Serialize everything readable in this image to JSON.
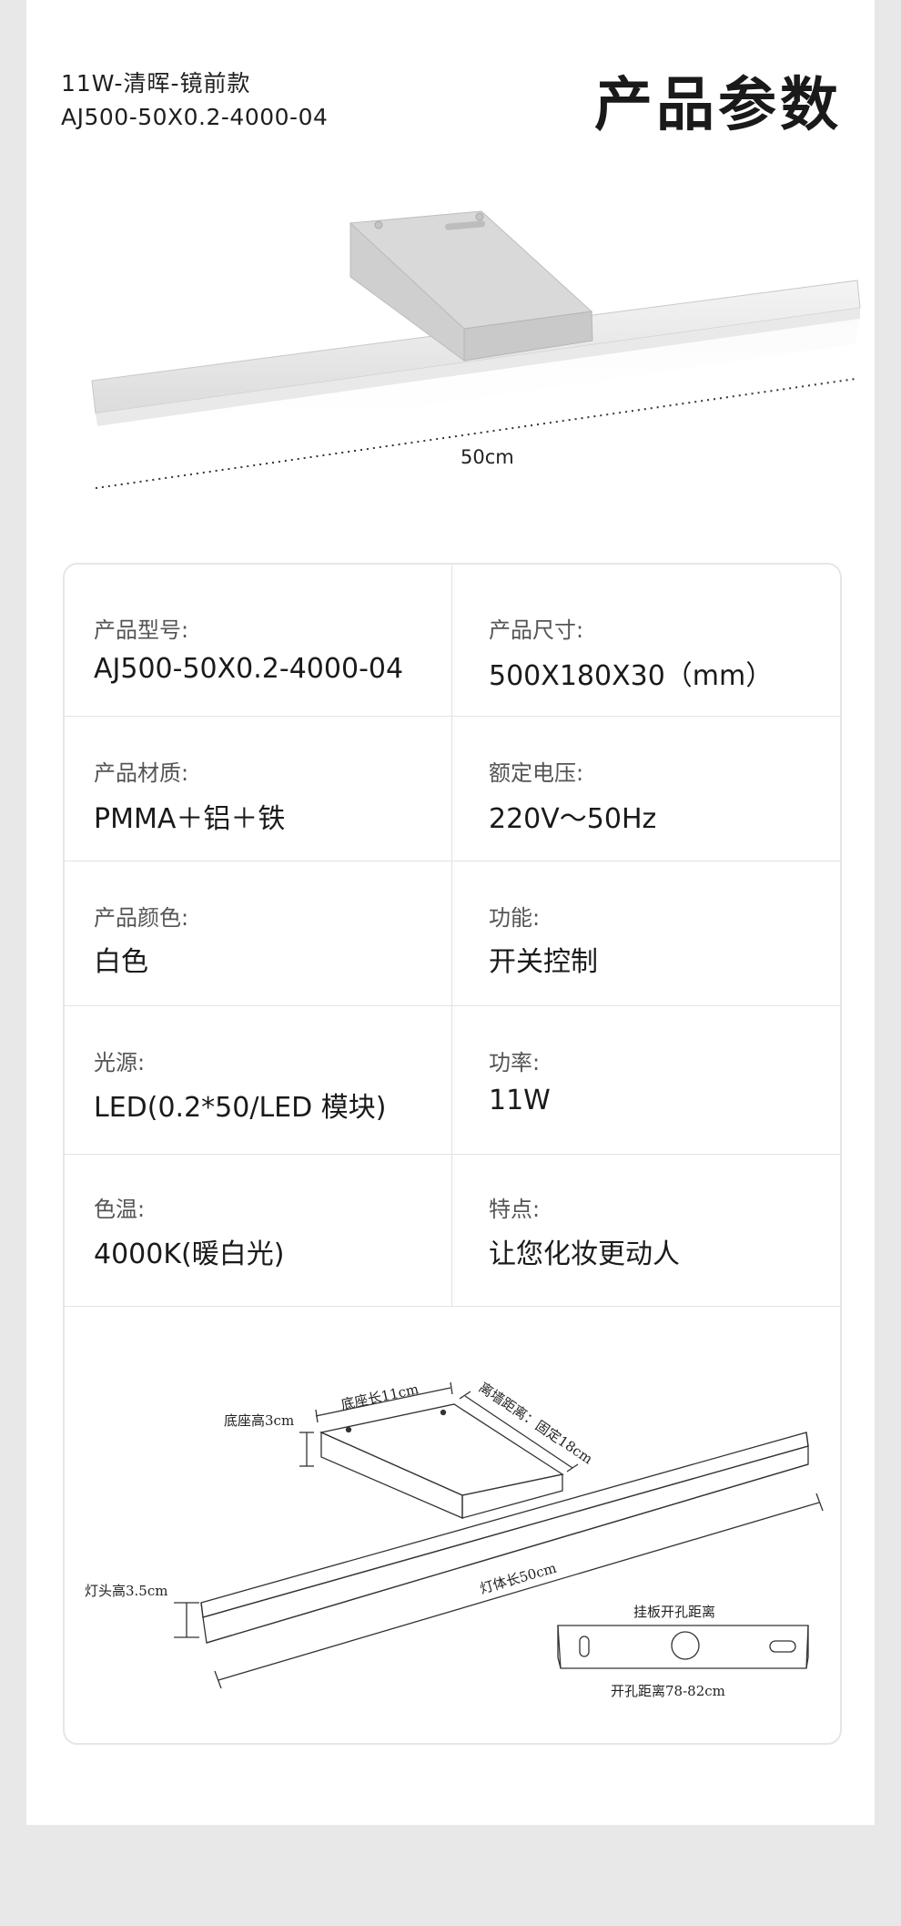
{
  "header": {
    "model_name": "11W-清晖-镜前款",
    "model_code": "AJ500-50X0.2-4000-04",
    "page_title": "产品参数"
  },
  "product_image": {
    "length_label": "50cm"
  },
  "specs": [
    {
      "label": "产品型号:",
      "value": "AJ500-50X0.2-4000-04"
    },
    {
      "label": "产品尺寸:",
      "value": "500X180X30（mm）"
    },
    {
      "label": "产品材质:",
      "value": "PMMA＋铝＋铁"
    },
    {
      "label": "额定电压:",
      "value": "220V～50Hz"
    },
    {
      "label": "产品颜色:",
      "value": "白色"
    },
    {
      "label": "功能:",
      "value": "开关控制"
    },
    {
      "label": "光源:",
      "value": "LED(0.2*50/LED 模块)"
    },
    {
      "label": "功率:",
      "value": "11W"
    },
    {
      "label": "色温:",
      "value": "4000K(暖白光)"
    },
    {
      "label": "特点:",
      "value": "让您化妆更动人"
    }
  ],
  "diagram": {
    "base_length": "底座长11cm",
    "base_height": "底座高3cm",
    "wall_distance": "离墙距离：固定18cm",
    "head_height": "灯头高3.5cm",
    "body_length": "灯体长50cm",
    "plate_title": "挂板开孔距离",
    "hole_distance": "开孔距离78-82cm"
  }
}
